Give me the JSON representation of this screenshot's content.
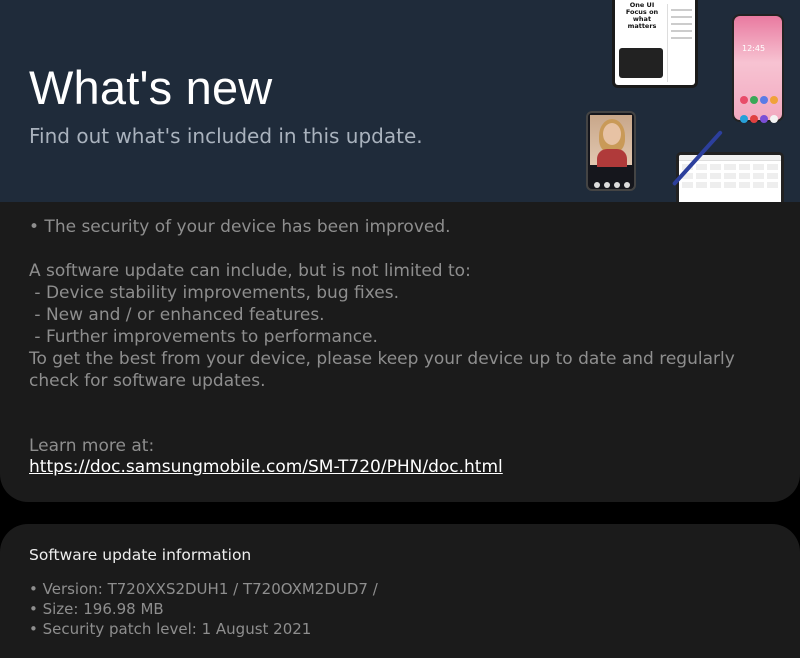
{
  "hero": {
    "title": "What's new",
    "subtitle": "Find out what's included in this update."
  },
  "notes": {
    "security": "• The security of your device has been improved.",
    "intro": "A software update can include, but is not limited to:",
    "items": [
      " - Device stability improvements, bug fixes.",
      " - New and / or enhanced features.",
      " - Further improvements to performance."
    ],
    "advice": "To get the best from your device, please keep your device up to date and regularly check for software updates."
  },
  "learn_more": {
    "label": "Learn more at:",
    "url": "https://doc.samsungmobile.com/SM-T720/PHN/doc.html"
  },
  "info": {
    "title": "Software update information",
    "version": "• Version: T720XXS2DUH1 / T720OXM2DUD7 /",
    "size": "• Size: 196.98 MB",
    "patch": "• Security patch level: 1 August 2021"
  },
  "illustration": {
    "tablet_text": [
      "One UI",
      "Focus on",
      "what matters"
    ],
    "clock": "12:45"
  },
  "colors": {
    "hero_bg": "#1f2b3a",
    "card_bg": "#1b1b1b",
    "page_bg": "#000000",
    "link": "#ffffff"
  }
}
